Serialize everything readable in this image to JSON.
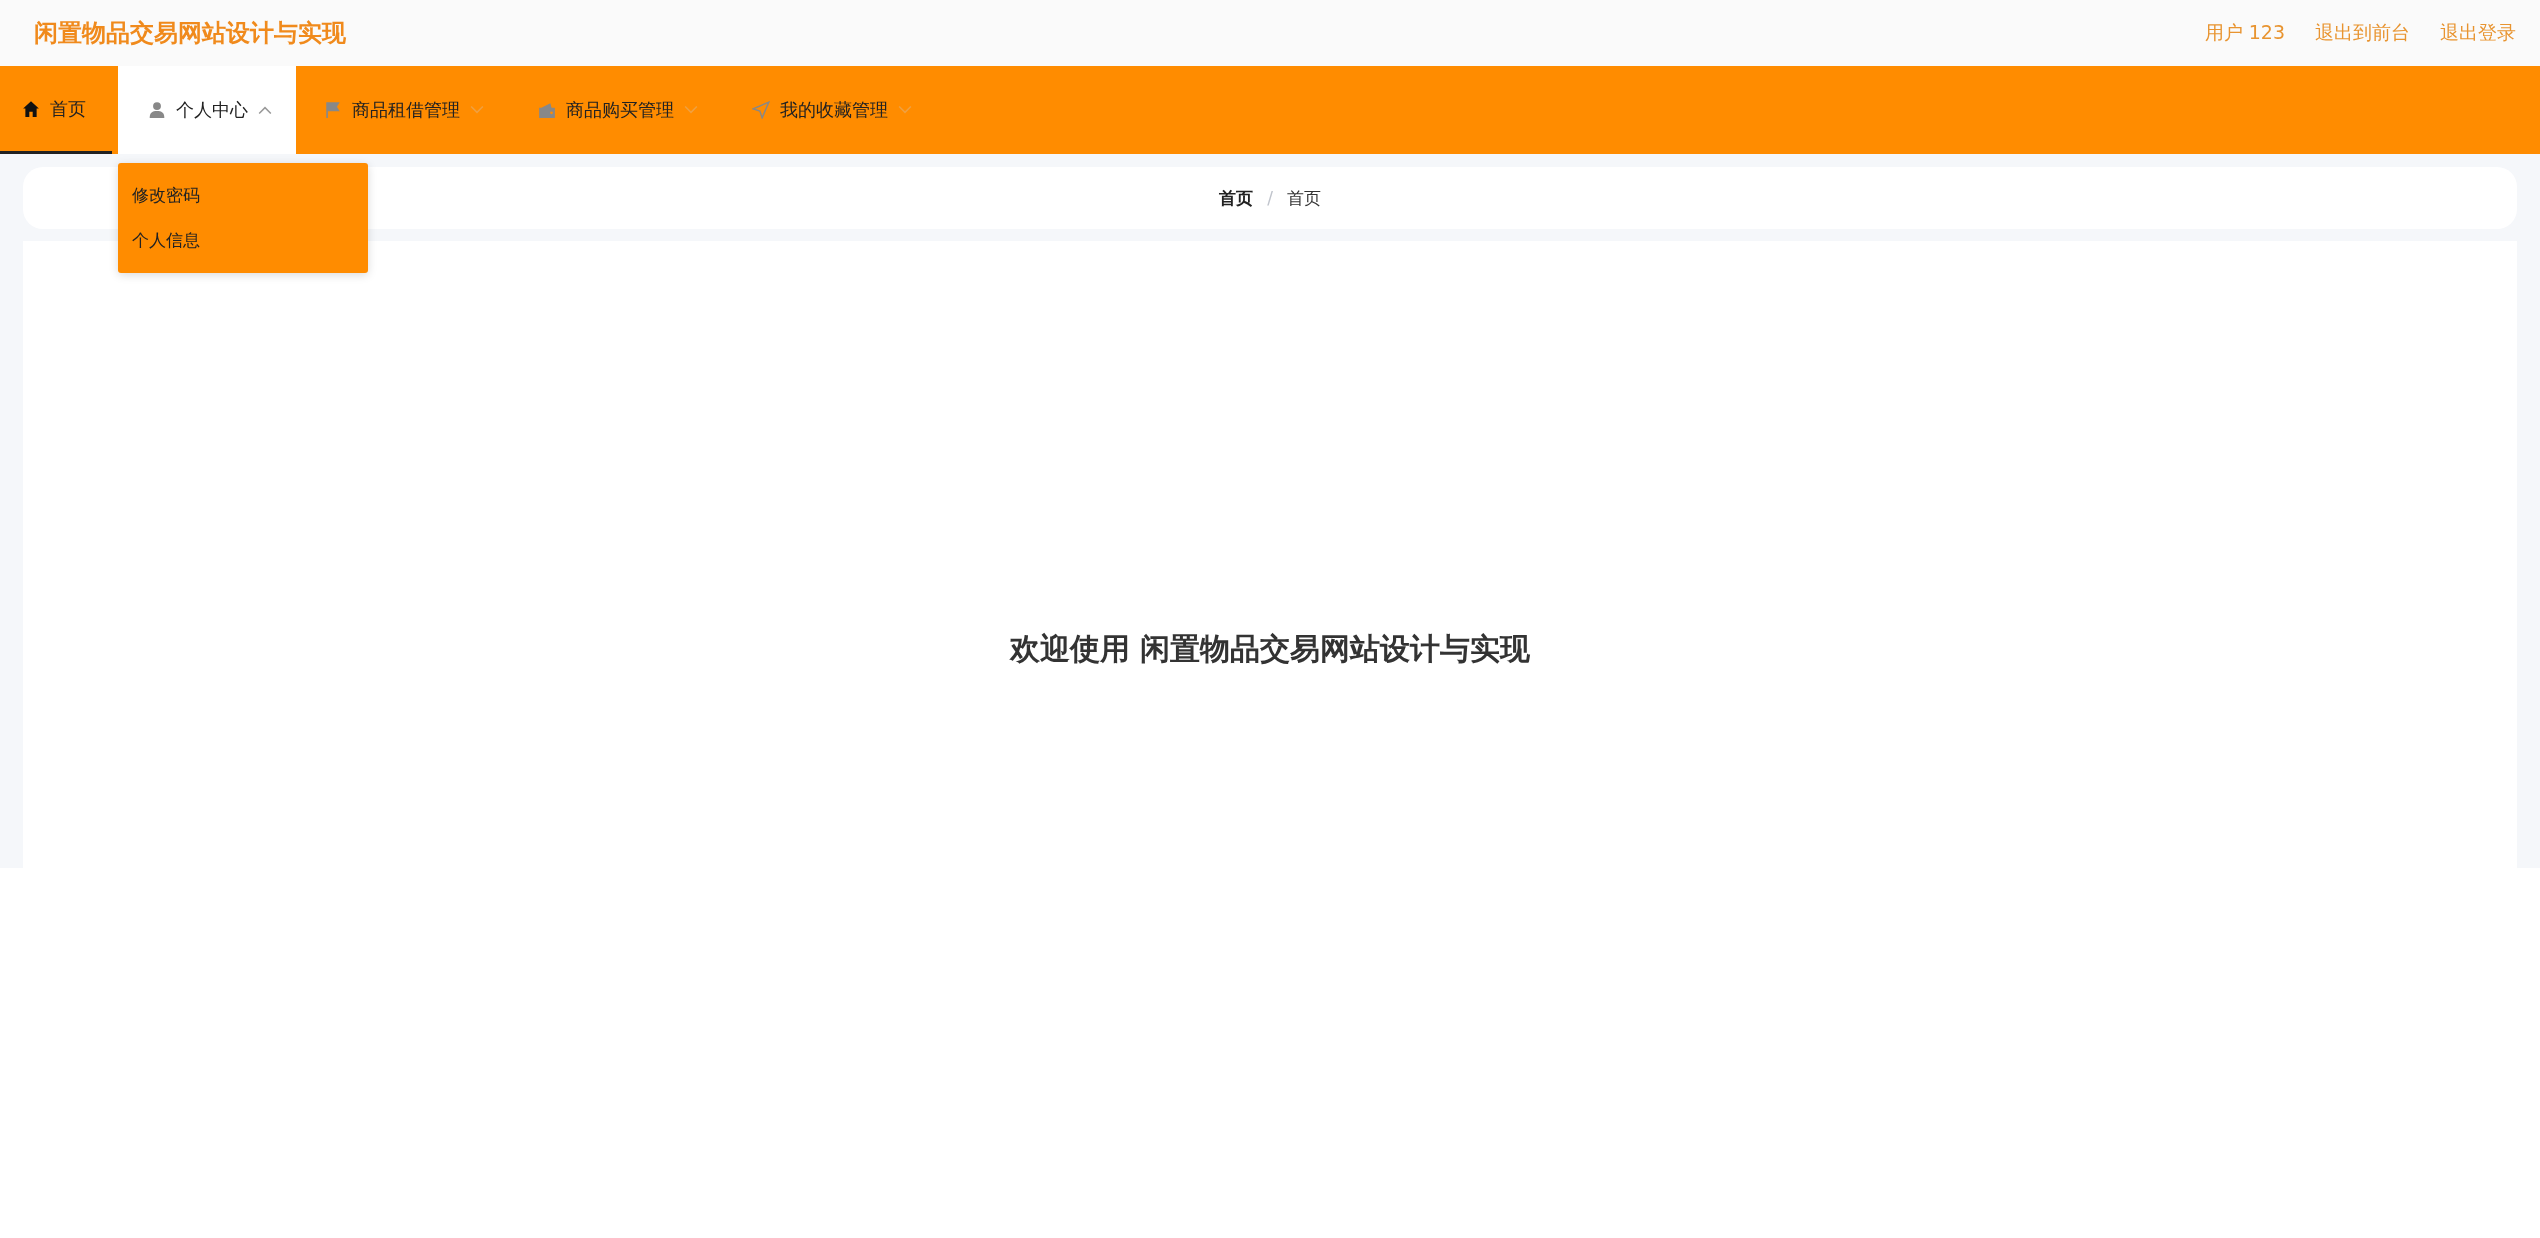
{
  "header": {
    "title": "闲置物品交易网站设计与实现",
    "links": [
      {
        "label": "用户 123"
      },
      {
        "label": "退出到前台"
      },
      {
        "label": "退出登录"
      }
    ]
  },
  "menu": [
    {
      "label": "首页",
      "selected": true,
      "expanded": false
    },
    {
      "label": "个人中心",
      "selected": false,
      "expanded": true,
      "children": [
        {
          "label": "修改密码"
        },
        {
          "label": "个人信息"
        }
      ]
    },
    {
      "label": "商品租借管理",
      "selected": false,
      "expanded": false
    },
    {
      "label": "商品购买管理",
      "selected": false,
      "expanded": false
    },
    {
      "label": "我的收藏管理",
      "selected": false,
      "expanded": false
    }
  ],
  "breadcrumb": {
    "separator": "/",
    "items": [
      "首页",
      "首页"
    ]
  },
  "welcome": "欢迎使用 闲置物品交易网站设计与实现"
}
